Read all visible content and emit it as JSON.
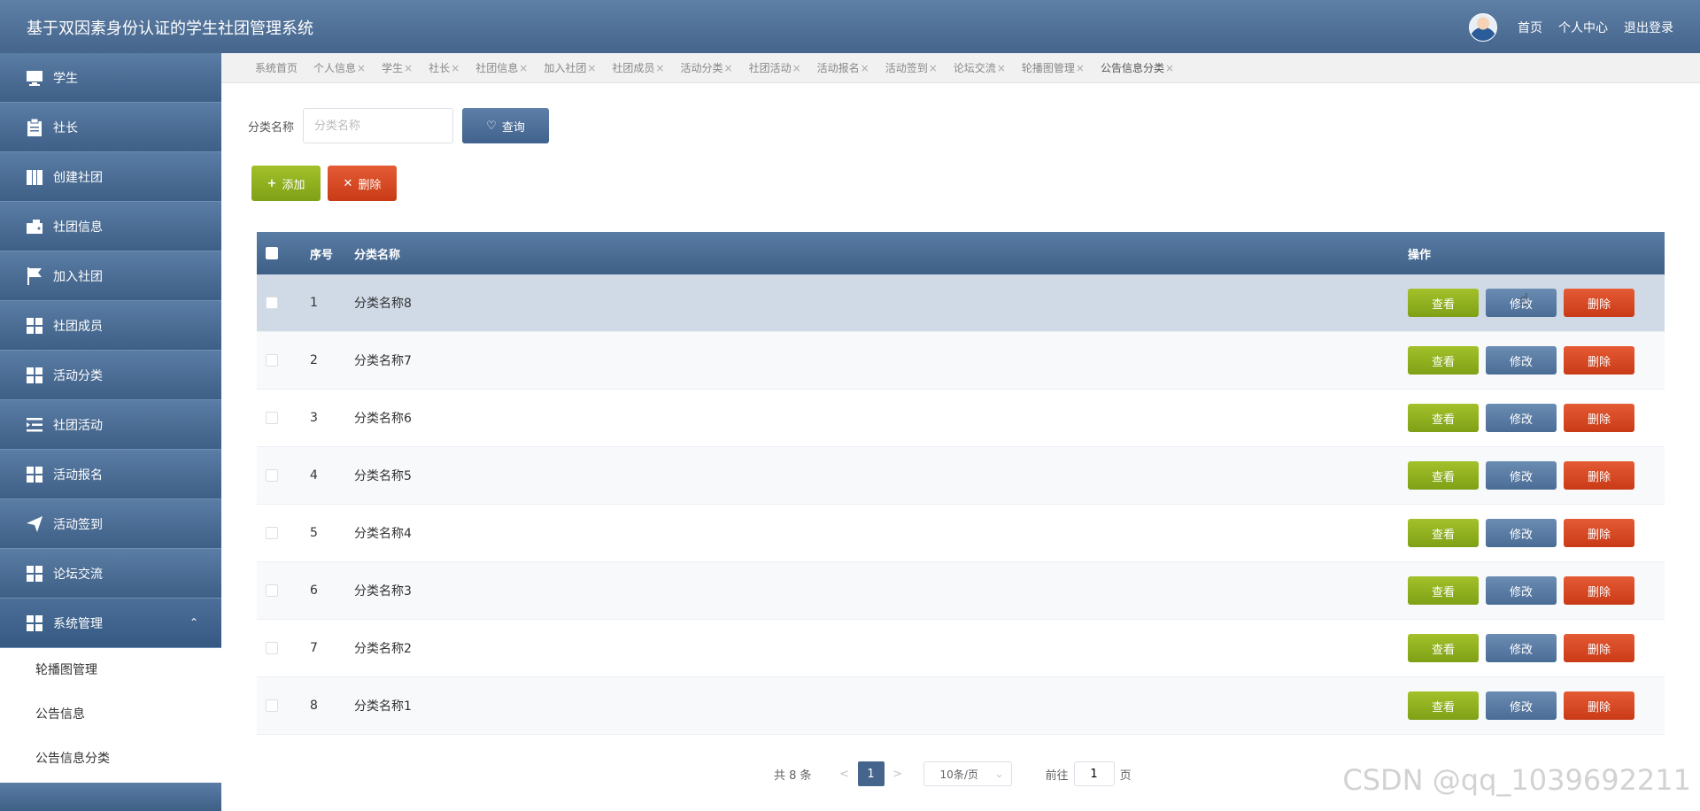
{
  "header": {
    "title": "基于双因素身份认证的学生社团管理系统",
    "nav": [
      "首页",
      "个人中心",
      "退出登录"
    ]
  },
  "sidebar": {
    "items": [
      {
        "label": "学生",
        "icon": "monitor-icon"
      },
      {
        "label": "社长",
        "icon": "clipboard-icon"
      },
      {
        "label": "创建社团",
        "icon": "book-icon"
      },
      {
        "label": "社团信息",
        "icon": "wallet-icon"
      },
      {
        "label": "加入社团",
        "icon": "flag-icon"
      },
      {
        "label": "社团成员",
        "icon": "grid-icon"
      },
      {
        "label": "活动分类",
        "icon": "grid-icon"
      },
      {
        "label": "社团活动",
        "icon": "list-icon"
      },
      {
        "label": "活动报名",
        "icon": "grid-icon"
      },
      {
        "label": "活动签到",
        "icon": "send-icon"
      },
      {
        "label": "论坛交流",
        "icon": "grid-icon"
      },
      {
        "label": "系统管理",
        "icon": "grid-icon"
      }
    ],
    "submenu": [
      "轮播图管理",
      "公告信息",
      "公告信息分类"
    ]
  },
  "tabs": [
    {
      "label": "系统首页",
      "closable": false
    },
    {
      "label": "个人信息",
      "closable": true
    },
    {
      "label": "学生",
      "closable": true
    },
    {
      "label": "社长",
      "closable": true
    },
    {
      "label": "社团信息",
      "closable": true
    },
    {
      "label": "加入社团",
      "closable": true
    },
    {
      "label": "社团成员",
      "closable": true
    },
    {
      "label": "活动分类",
      "closable": true
    },
    {
      "label": "社团活动",
      "closable": true
    },
    {
      "label": "活动报名",
      "closable": true
    },
    {
      "label": "活动签到",
      "closable": true
    },
    {
      "label": "论坛交流",
      "closable": true
    },
    {
      "label": "轮播图管理",
      "closable": true
    },
    {
      "label": "公告信息分类",
      "closable": true
    }
  ],
  "tab_close": "×",
  "search": {
    "label": "分类名称",
    "placeholder": "分类名称",
    "value": "",
    "query_label": "查询"
  },
  "actions": {
    "add_label": "添加",
    "delete_label": "删除"
  },
  "table": {
    "headers": {
      "index": "序号",
      "name": "分类名称",
      "ops": "操作"
    },
    "rows": [
      {
        "index": "1",
        "name": "分类名称8"
      },
      {
        "index": "2",
        "name": "分类名称7"
      },
      {
        "index": "3",
        "name": "分类名称6"
      },
      {
        "index": "4",
        "name": "分类名称5"
      },
      {
        "index": "5",
        "name": "分类名称4"
      },
      {
        "index": "6",
        "name": "分类名称3"
      },
      {
        "index": "7",
        "name": "分类名称2"
      },
      {
        "index": "8",
        "name": "分类名称1"
      }
    ],
    "row_buttons": {
      "view": "查看",
      "edit": "修改",
      "remove": "删除"
    }
  },
  "pager": {
    "total": "共 8 条",
    "prev": "<",
    "page": "1",
    "next": ">",
    "size": "10条/页",
    "goto_label": "前往",
    "goto_value": "1",
    "goto_suffix": "页"
  },
  "watermark": "CSDN @qq_1039692211",
  "colors": {
    "header": "#4f719a",
    "green": "#8fb020",
    "red": "#d8491f",
    "blue": "#5a7da5"
  }
}
